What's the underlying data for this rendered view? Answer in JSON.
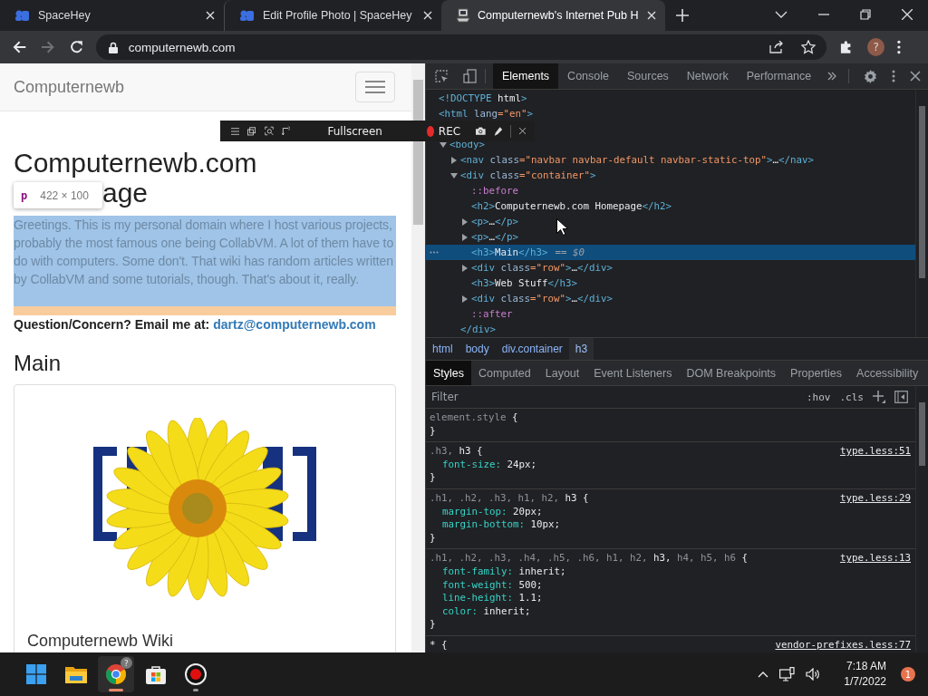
{
  "browser": {
    "tabs": [
      {
        "title": "SpaceHey",
        "selected": false
      },
      {
        "title": "Edit Profile Photo | SpaceHey",
        "selected": false
      },
      {
        "title": "Computernewb's Internet Pub H",
        "selected": true
      }
    ],
    "address": "computernewb.com",
    "avatar": "?"
  },
  "page": {
    "brand": "Computernewb",
    "heading_line1": "Computernewb.com",
    "heading_line2_visible": "age",
    "intro": "Greetings. This is my personal domain where I host various projects, probably the most famous one being CollabVM. A lot of them have to do with computers. Some don't. That wiki has random articles written by CollabVM and some tutorials, though. That's about it, really.",
    "contact_label": "Question/Concern? Email me at:",
    "contact_email": "dartz@computernewb.com",
    "section_title": "Main",
    "card_title": "Computernewb Wiki"
  },
  "inspect_tooltip": {
    "tag": "p",
    "size": "422 × 100"
  },
  "recorder": {
    "mode": "Fullscreen",
    "status": "REC"
  },
  "devtools": {
    "tabs": [
      {
        "label": "Elements",
        "selected": true
      },
      {
        "label": "Console",
        "selected": false
      },
      {
        "label": "Sources",
        "selected": false
      },
      {
        "label": "Network",
        "selected": false
      },
      {
        "label": "Performance",
        "selected": false
      }
    ],
    "dom": [
      {
        "text": "<!DOCTYPE html>",
        "selected": false
      },
      {
        "text": "<html lang=\"en\">",
        "selected": false,
        "children": [
          {
            "text": "<body>",
            "expanded": true,
            "selected": false,
            "children": [
              {
                "text": "<nav class=\"navbar navbar-default navbar-static-top\">…</nav>",
                "expanded": false,
                "selected": false
              },
              {
                "text": "<div class=\"container\">",
                "expanded": true,
                "selected": false,
                "children": [
                  {
                    "text": "::before",
                    "selected": false
                  },
                  {
                    "text": "<h2>Computernewb.com Homepage</h2>",
                    "selected": false
                  },
                  {
                    "text": "<p>…</p>",
                    "expanded": false,
                    "selected": false
                  },
                  {
                    "text": "<p>…</p>",
                    "expanded": false,
                    "selected": false
                  },
                  {
                    "text": "<h3>Main</h3>",
                    "selected": true,
                    "console_ref": "== $0"
                  },
                  {
                    "text": "<div class=\"row\">…</div>",
                    "expanded": false,
                    "selected": false
                  },
                  {
                    "text": "<h3>Web Stuff</h3>",
                    "selected": false
                  },
                  {
                    "text": "<div class=\"row\">…</div>",
                    "expanded": false,
                    "selected": false
                  },
                  {
                    "text": "::after",
                    "selected": false
                  }
                ]
              },
              {
                "text": "</div>",
                "selected": false
              }
            ]
          }
        ]
      }
    ],
    "breadcrumb": [
      {
        "label": "html",
        "selected": false
      },
      {
        "label": "body",
        "selected": false
      },
      {
        "label": "div.container",
        "selected": false
      },
      {
        "label": "h3",
        "selected": true
      }
    ],
    "style_tabs": [
      {
        "label": "Styles",
        "selected": true
      },
      {
        "label": "Computed",
        "selected": false
      },
      {
        "label": "Layout",
        "selected": false
      },
      {
        "label": "Event Listeners",
        "selected": false
      },
      {
        "label": "DOM Breakpoints",
        "selected": false
      },
      {
        "label": "Properties",
        "selected": false
      },
      {
        "label": "Accessibility",
        "selected": false
      }
    ],
    "filter": {
      "placeholder": "Filter"
    },
    "state_buttons": [
      ":hov",
      ".cls"
    ],
    "rules": [
      {
        "selector": [
          {
            "text": "element.style",
            "matched": false
          },
          {
            "text": "{",
            "matched": true
          }
        ],
        "close": "}"
      },
      {
        "selector": [
          {
            "text": ".h3,",
            "matched": false
          },
          {
            "text": "h3",
            "matched": true
          },
          {
            "text": "{",
            "matched": true
          }
        ],
        "source": "type.less:51",
        "declarations": [
          {
            "property": "font-size:",
            "value": "24px;"
          }
        ],
        "close": "}"
      },
      {
        "selector": [
          {
            "text": ".h1, .h2, .h3, h1, h2,",
            "matched": false
          },
          {
            "text": "h3",
            "matched": true
          },
          {
            "text": "{",
            "matched": true
          }
        ],
        "source": "type.less:29",
        "declarations": [
          {
            "property": "margin-top:",
            "value": "20px;"
          },
          {
            "property": "margin-bottom:",
            "value": "10px;"
          }
        ],
        "close": "}"
      },
      {
        "selector": [
          {
            "text": ".h1, .h2, .h3, .h4, .h5, .h6, h1, h2,",
            "matched": false
          },
          {
            "text": "h3,",
            "matched": true
          },
          {
            "text": "h4, h5, h6",
            "matched": false
          },
          {
            "text": "{",
            "matched": true
          }
        ],
        "source": "type.less:13",
        "declarations": [
          {
            "property": "font-family:",
            "value": "inherit;"
          },
          {
            "property": "font-weight:",
            "value": "500;"
          },
          {
            "property": "line-height:",
            "value": "1.1;"
          },
          {
            "property": "color:",
            "value": "inherit;"
          }
        ],
        "close": "}"
      },
      {
        "selector": [
          {
            "text": "*",
            "matched": true
          },
          {
            "text": "{",
            "matched": true
          }
        ],
        "source": "vendor-prefixes.less:77"
      }
    ]
  },
  "taskbar": {
    "apps": [
      {
        "kind": "start",
        "active": false,
        "running": false
      },
      {
        "kind": "explorer",
        "active": false,
        "running": false
      },
      {
        "kind": "chrome",
        "active": true,
        "running": true,
        "badge": "?"
      },
      {
        "kind": "store",
        "active": false,
        "running": false
      },
      {
        "kind": "recorder",
        "active": false,
        "running": true
      }
    ],
    "time": "7:18 AM",
    "date": "1/7/2022",
    "notifications": "1"
  }
}
